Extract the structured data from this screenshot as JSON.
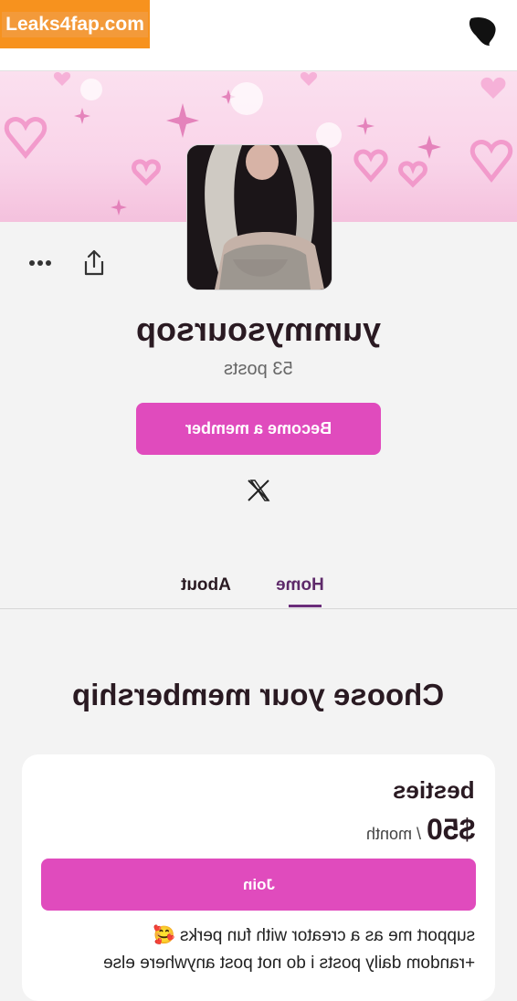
{
  "watermark": {
    "text": "Leaks4fap.com"
  },
  "creator": {
    "name": "yummysoursop",
    "post_count": "53 posts"
  },
  "actions": {
    "become_member_label": "Become a member"
  },
  "tabs": [
    {
      "label": "Home",
      "active": true
    },
    {
      "label": "About",
      "active": false
    }
  ],
  "membership": {
    "section_title": "Choose your membership",
    "tiers": [
      {
        "name": "besties",
        "price": "$50",
        "period": "/ month",
        "join_label": "Join",
        "perks": [
          "support me as a creator with fun perks 🥰",
          "+random daily posts i do not post anywhere else"
        ]
      }
    ]
  },
  "icons": {
    "more": "more-horizontal-icon",
    "share": "share-icon",
    "x_social": "x-social-icon",
    "logo": "patreon-logo-icon"
  },
  "colors": {
    "accent": "#e04bbd",
    "watermark": "#f7921e",
    "active_tab": "#6a2c7a"
  }
}
